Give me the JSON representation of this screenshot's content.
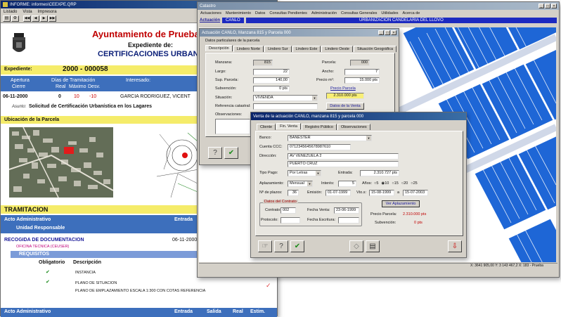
{
  "w1": {
    "title": "INFORME: informes\\CEEXPE.QRP",
    "menu": [
      "Listado",
      "Vista",
      "Impresora"
    ],
    "nav": [
      "◀◀",
      "◀",
      "▶",
      "▶▶"
    ],
    "org": "Ayuntamiento de Prueba",
    "expediente_de": "Expediente de:",
    "tipo": "CERTIFICACIONES URBANIST",
    "exp_label": "Expediente:",
    "exp_value": "2000 - 000058",
    "col_apertura": "Apertura",
    "col_dias": "Días de Tramitación",
    "col_interesado": "Interesado:",
    "sub_cierre": "Cierre",
    "sub_real": "Real",
    "sub_maximo": "Máximo",
    "sub_desv": "Desv.",
    "fecha": "06-11-2000",
    "real": "0",
    "maximo": "10",
    "desv": "-10",
    "interesado": "GARCIA RODRIGUEZ, VICENT",
    "asunto_label": "Asunto:",
    "asunto": "Solicitud de Certificación Urbanística en los Lagares",
    "ubicacion": "Ubicación de la Parcela",
    "tramitacion": "TRAMITACION",
    "acto": "Acto Administrativo",
    "entrada": "Entrada",
    "unidad": "Unidad Responsable",
    "recogida": "RECOGIDA DE DOCUMENTACION",
    "oficina": "OFICINA TECNICA (CEUSER)",
    "recogida_fecha": "06-11-2000",
    "requisitos": "REQUISITOS",
    "obligatorio": "Obligatorio",
    "descripcion": "Descripción",
    "req": [
      "INSTANCIA",
      "PLANO DE SITUACION",
      "PLANO DE EMPLAZAMIENTO ESCALA 1:300 CON COTAS REFERENCIA"
    ],
    "footer_acto": "Acto Administrativo",
    "footer_entrada": "Entrada",
    "footer_salida": "Salida",
    "footer_real": "Real",
    "footer_estim": "Estim."
  },
  "w2": {
    "title": "Catastro",
    "menu": [
      "Actuaciones",
      "Mantenimiento",
      "Datos",
      "Consultas Pendientes",
      "Administración",
      "Consultas Generales",
      "Utilidades",
      "Acerca de"
    ],
    "tab_actuacion": "Actuación",
    "tab_canlo": "CANLO",
    "header_text": "URBANIZACION CANDELARIA DEL LLOVO",
    "status": "X: 3641 905,00  Y: 3 143 467,2 X: 183 - Prueba"
  },
  "w3": {
    "title": "Actuación CANLO, Manzana 815 y Parcela 000",
    "tabs": [
      "Descripción",
      "Lindero Norte",
      "Lindero Sur",
      "Lindero Este",
      "Lindero Oeste",
      "Situación Geográfica"
    ],
    "subtitle": "Datos particulares de la parcela",
    "manzana_l": "Manzana:",
    "manzana": "815",
    "parcela_l": "Parcela:",
    "parcela": "000",
    "largo_l": "Largo:",
    "largo": "22",
    "ancho_l": "Ancho:",
    "ancho": "7",
    "sup_l": "Sup. Parcela:",
    "sup": "140,00",
    "precio_l": "Precio m²:",
    "precio": "15.000 pts",
    "sub_l": "Subvención:",
    "sub": "0 pts",
    "precio_parcela_l": "Precio Parcela",
    "precio_parcela": "2.310.000 pts",
    "sit_l": "Situación:",
    "sit": "VIVIENDA",
    "ref_l": "Referencia catastral:",
    "datos_venta": "Datos de la Venta",
    "obs_l": "Observaciones:"
  },
  "w4": {
    "title": "Venta de la actuación CANLO, manzana 815 y parcela 000",
    "tabs": [
      "Cliente",
      "Fin. Venta",
      "Registro Público",
      "Observaciones"
    ],
    "banco_l": "Banco:",
    "banco": "BANESTER",
    "cuenta_l": "Cuenta CCC:",
    "cuenta": "0712345645678987610",
    "dir_l": "Dirección:",
    "dir": "AV VENEZUELA 2",
    "poblacion": "PUERTO CRUZ",
    "tipo_pago_l": "Tipo Pago:",
    "tipo_pago": "Por Letras",
    "entrada_l": "Entrada:",
    "entrada": "2.310.727 pts",
    "aplazamiento_l": "Aplazamiento:",
    "aplazamiento": "Mensual",
    "interes_l": "Interés:",
    "interes": "5",
    "anos_l": "Años:",
    "anos_opts": [
      "5",
      "10",
      "15",
      "20",
      "25"
    ],
    "plazos_l": "Nº de plazos:",
    "plazos": "36",
    "emision_l": "Emisión:",
    "emision": "01-07-1999",
    "vto_l": "Vto.s:",
    "vto": "15-08-1999",
    "vto_sep": "a",
    "vto2": "15-07-2003",
    "contrato_group": "Datos del Contrato",
    "contrato_l": "Contrato:",
    "contrato": "002",
    "fventa_l": "Fecha Venta:",
    "fventa": "23-06-1999",
    "protocolo_l": "Protocolo:",
    "fescritura_l": "Fecha Escritura:",
    "ver_aplazamiento": "Ver Aplazamiento",
    "precio_parcela_l": "Precio Parcela:",
    "precio_parcela": "2.310.000 pts",
    "subvencion_l": "Subvención:",
    "subvencion": "0 pts"
  }
}
